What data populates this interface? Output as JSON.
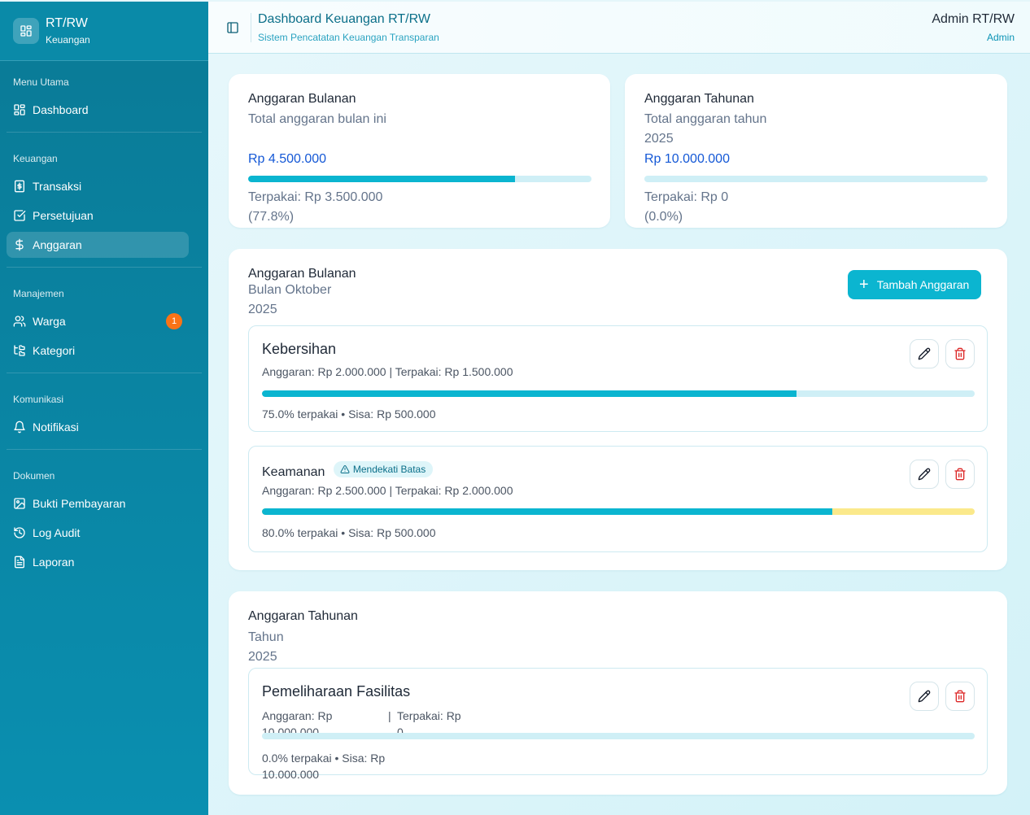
{
  "sidebar": {
    "brand_title": "RT/RW",
    "brand_sub": "Keuangan",
    "groups": [
      {
        "label": "Menu Utama",
        "items": [
          {
            "label": "Dashboard",
            "icon": "dashboard-icon"
          }
        ]
      },
      {
        "label": "Keuangan",
        "items": [
          {
            "label": "Transaksi",
            "icon": "receipt-icon"
          },
          {
            "label": "Persetujuan",
            "icon": "check-square-icon"
          },
          {
            "label": "Anggaran",
            "icon": "dollar-icon",
            "active": true
          }
        ]
      },
      {
        "label": "Manajemen",
        "items": [
          {
            "label": "Warga",
            "icon": "users-icon",
            "badge": "1"
          },
          {
            "label": "Kategori",
            "icon": "category-tree-icon"
          }
        ]
      },
      {
        "label": "Komunikasi",
        "items": [
          {
            "label": "Notifikasi",
            "icon": "bell-icon"
          }
        ]
      },
      {
        "label": "Dokumen",
        "items": [
          {
            "label": "Bukti Pembayaran",
            "icon": "image-icon"
          },
          {
            "label": "Log Audit",
            "icon": "history-icon"
          },
          {
            "label": "Laporan",
            "icon": "file-text-icon"
          }
        ]
      }
    ]
  },
  "header": {
    "title": "Dashboard Keuangan RT/RW",
    "subtitle": "Sistem Pencatatan Keuangan Transparan",
    "user_name": "Admin RT/RW",
    "user_role": "Admin"
  },
  "summary": {
    "monthly": {
      "title": "Anggaran Bulanan",
      "subtitle": "Total anggaran bulan ini",
      "amount": "Rp 4.500.000",
      "used_label": "Terpakai: Rp 3.500.000",
      "used_pct_label": "(77.8%)",
      "used_fraction": 0.778
    },
    "yearly": {
      "title": "Anggaran Tahunan",
      "subtitle_line1": "Total anggaran tahun",
      "subtitle_line2": "2025",
      "amount": "Rp 10.000.000",
      "used_label": "Terpakai: Rp 0",
      "used_pct_label": "(0.0%)",
      "used_fraction": 0.0
    }
  },
  "monthly_section": {
    "title": "Anggaran Bulanan",
    "subtitle_line1": "Bulan Oktober",
    "subtitle_line2": "2025",
    "add_button": "Tambah Anggaran",
    "items": [
      {
        "name": "Kebersihan",
        "detail": "Anggaran: Rp 2.000.000 | Terpakai: Rp 1.500.000",
        "footer": "75.0% terpakai • Sisa: Rp 500.000",
        "used_fraction": 0.75,
        "warning": ""
      },
      {
        "name": "Keamanan",
        "detail": "Anggaran: Rp 2.500.000 | Terpakai: Rp 2.000.000",
        "footer": "80.0% terpakai • Sisa: Rp 500.000",
        "used_fraction": 0.8,
        "warning": "Mendekati Batas"
      }
    ]
  },
  "yearly_section": {
    "title": "Anggaran Tahunan",
    "subtitle_line1": "Tahun",
    "subtitle_line2": "2025",
    "items": [
      {
        "name": "Pemeliharaan Fasilitas",
        "budget_line1": "Anggaran: Rp",
        "budget_line2": "10.000.000",
        "sep": "|",
        "used_line1": "Terpakai: Rp",
        "used_line2": "0",
        "footer_line1": "0.0% terpakai • Sisa: Rp",
        "footer_line2": "10.000.000",
        "used_fraction": 0.0
      }
    ]
  },
  "colors": {
    "accent": "#0bb5d0",
    "sidebar": "#0a8aa8",
    "warning_bar": "#fbe98b",
    "badge": "#f97316",
    "delete": "#dc2626"
  }
}
